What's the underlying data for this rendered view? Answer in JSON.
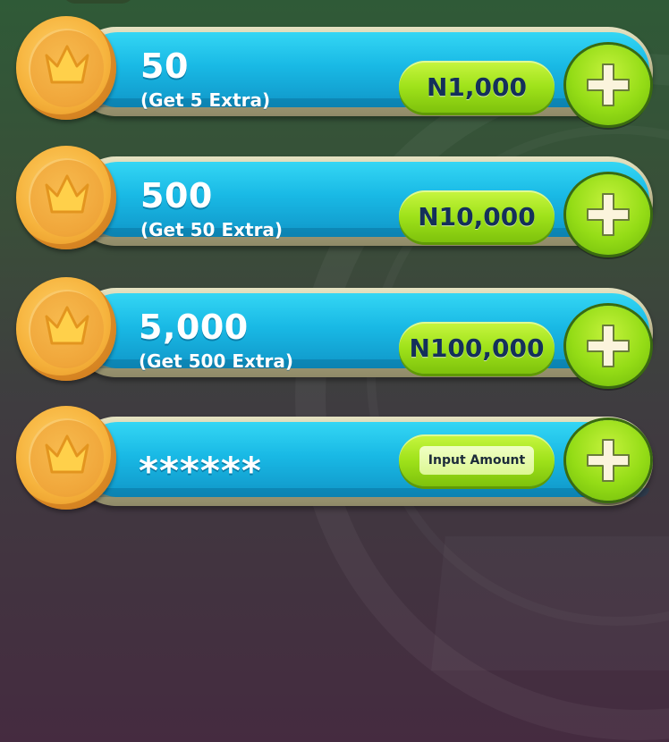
{
  "packages": [
    {
      "amount": "50",
      "extra": "(Get 5 Extra)",
      "price": "N1,000"
    },
    {
      "amount": "500",
      "extra": "(Get 50 Extra)",
      "price": "N10,000"
    },
    {
      "amount": "5,000",
      "extra": "(Get 500 Extra)",
      "price": "N100,000"
    }
  ],
  "custom": {
    "masked_amount": "******",
    "input_placeholder": "Input Amount"
  },
  "icons": {
    "coin": "crown-coin-icon",
    "add": "plus-icon"
  },
  "colors": {
    "bar": "#19b9e5",
    "button": "#9fe21a",
    "coin": "#f6b33d",
    "price_text": "#14305a"
  }
}
